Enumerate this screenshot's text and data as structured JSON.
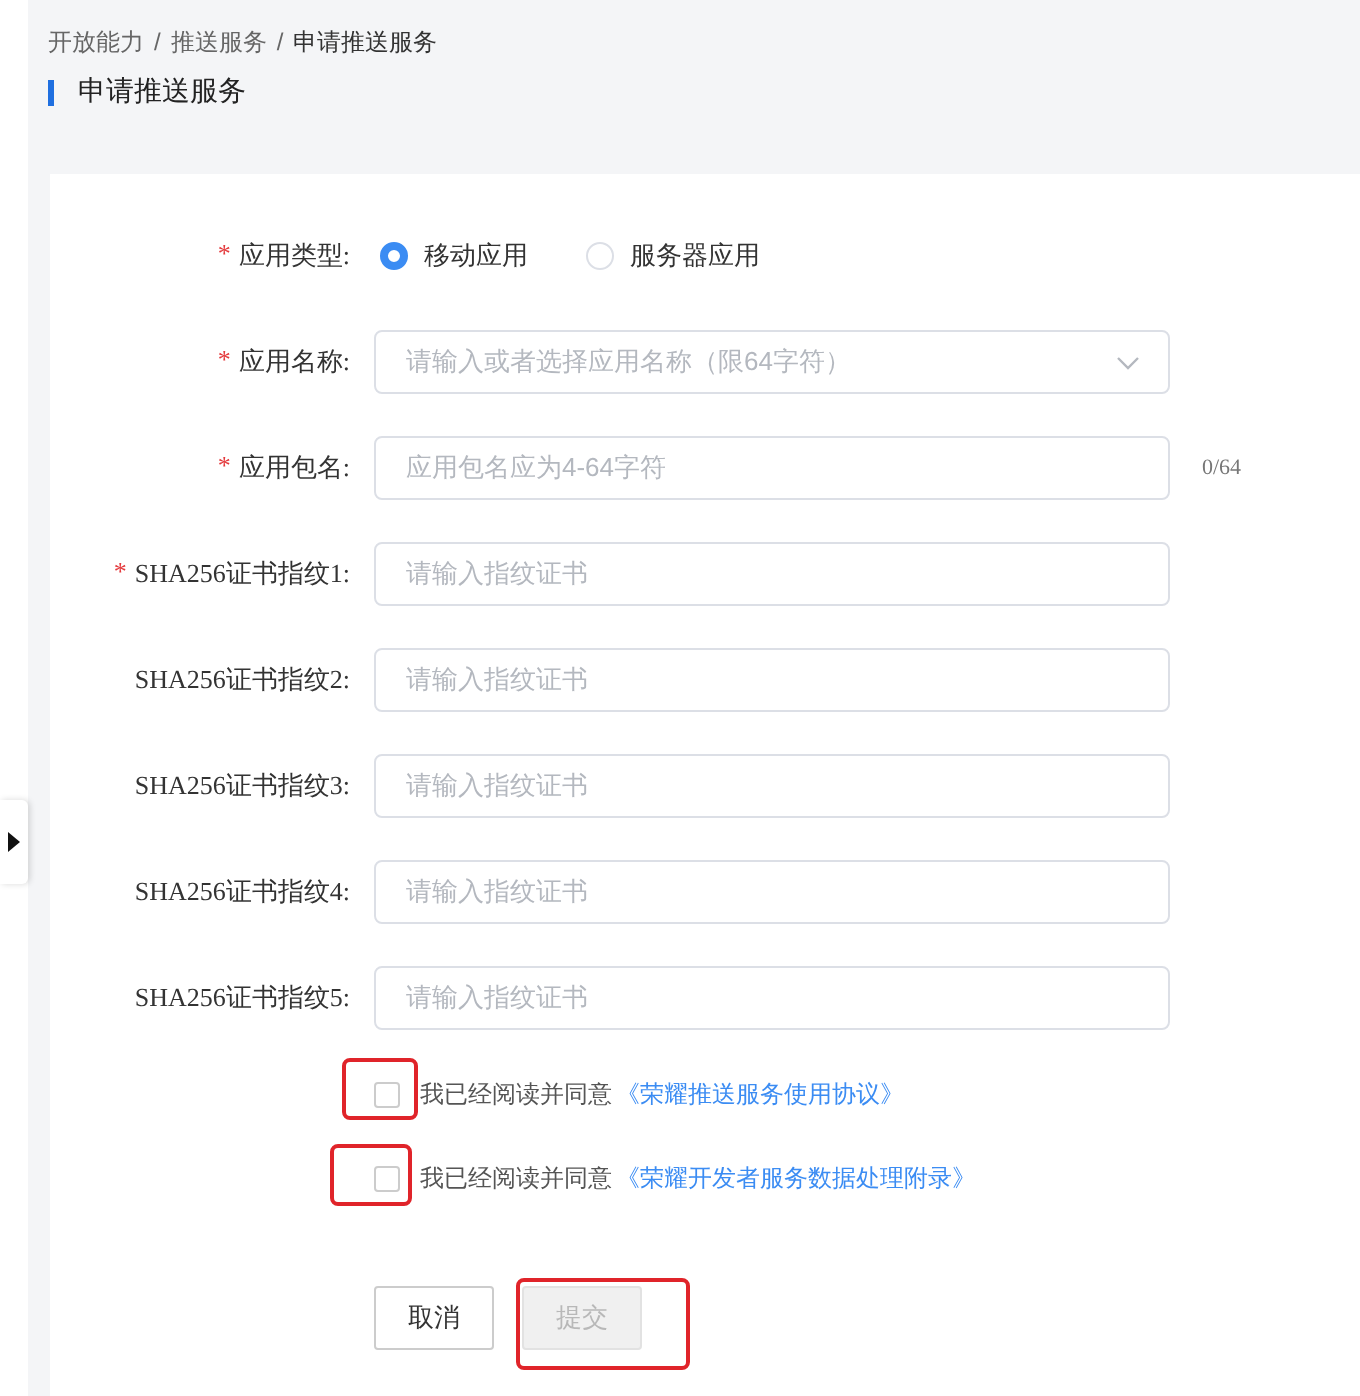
{
  "breadcrumb": {
    "items": [
      {
        "label": "开放能力",
        "current": false
      },
      {
        "label": "推送服务",
        "current": false
      },
      {
        "label": "申请推送服务",
        "current": true
      }
    ],
    "separators": [
      "/",
      "/"
    ]
  },
  "page_title": "申请推送服务",
  "form": {
    "fields": [
      {
        "kind": "radio",
        "label": "应用类型:",
        "required_mark": "*",
        "options": [
          {
            "label": "移动应用",
            "selected": true
          },
          {
            "label": "服务器应用",
            "selected": false
          }
        ]
      },
      {
        "kind": "select",
        "label": "应用名称:",
        "required_mark": "*",
        "placeholder": "请输入或者选择应用名称（限64字符）"
      },
      {
        "kind": "text",
        "label": "应用包名:",
        "required_mark": "*",
        "placeholder": "应用包名应为4-64字符",
        "counter": "0/64"
      },
      {
        "kind": "text",
        "label": "SHA256证书指纹1:",
        "required_mark": "*",
        "placeholder": "请输入指纹证书"
      },
      {
        "kind": "text",
        "label": "SHA256证书指纹2:",
        "placeholder": "请输入指纹证书"
      },
      {
        "kind": "text",
        "label": "SHA256证书指纹3:",
        "placeholder": "请输入指纹证书"
      },
      {
        "kind": "text",
        "label": "SHA256证书指纹4:",
        "placeholder": "请输入指纹证书"
      },
      {
        "kind": "text",
        "label": "SHA256证书指纹5:",
        "placeholder": "请输入指纹证书"
      }
    ],
    "agreements": [
      {
        "text": "我已经阅读并同意",
        "link": "《荣耀推送服务使用协议》",
        "checked": false,
        "highlighted": true
      },
      {
        "text": "我已经阅读并同意",
        "link": "《荣耀开发者服务数据处理附录》",
        "checked": false,
        "highlighted": true
      }
    ],
    "buttons": [
      {
        "label": "取消",
        "kind": "cancel",
        "disabled": false,
        "highlighted": false
      },
      {
        "label": "提交",
        "kind": "submit",
        "disabled": true,
        "highlighted": true
      }
    ]
  }
}
